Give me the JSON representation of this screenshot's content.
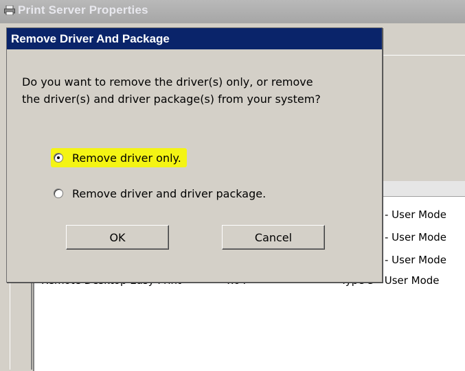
{
  "background_window": {
    "title": "Print Server Properties",
    "rows_type": [
      "- User Mode",
      "- User Mode",
      "- User Mode"
    ],
    "last_row": {
      "name": "Remote Desktop Easy Print",
      "env": "x64",
      "type": "Type 3 - User Mode"
    }
  },
  "dialog": {
    "title": "Remove Driver And Package",
    "question_line1": "Do you want to remove the driver(s) only, or remove",
    "question_line2": "the driver(s) and driver package(s) from your system?",
    "option_driver_only": "Remove driver only.",
    "option_driver_and_package": "Remove driver and driver package.",
    "selected_option": "Remove driver only.",
    "ok_label": "OK",
    "cancel_label": "Cancel",
    "highlight_color": "#f4f414",
    "titlebar_color": "#0a246a"
  }
}
